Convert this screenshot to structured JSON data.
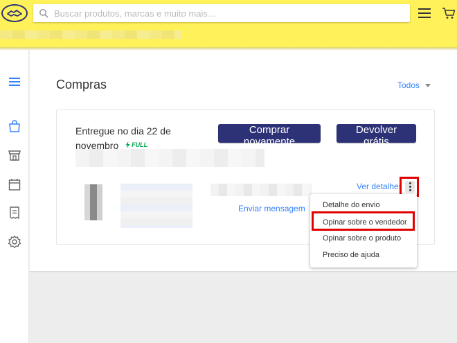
{
  "header": {
    "logo_icon": "mercadolivre-handshake-logo",
    "search": {
      "placeholder": "Buscar produtos, marcas e muito mais…",
      "value": ""
    },
    "menu_icon": "hamburger-menu-icon",
    "cart_icon": "cart-icon",
    "accent": "#fff159"
  },
  "sidebar": {
    "items": [
      {
        "icon": "hamburger-icon"
      },
      {
        "icon": "shopping-bag-icon",
        "active": true
      },
      {
        "icon": "store-icon"
      },
      {
        "icon": "calendar-icon"
      },
      {
        "icon": "receipt-icon"
      },
      {
        "icon": "settings-icon"
      }
    ]
  },
  "main": {
    "title": "Compras",
    "filter": {
      "label": "Todos"
    },
    "order": {
      "delivery_text": "Entregue no dia 22 de novembro",
      "full_badge": "FULL",
      "buy_again_label": "Comprar novamente",
      "return_label": "Devolver grátis",
      "send_message_label": "Enviar mensagem",
      "see_details_label": "Ver detalhes",
      "more_icon": "kebab-menu-icon"
    },
    "actions_menu": {
      "items": [
        {
          "label": "Detalhe do envio"
        },
        {
          "label": "Opinar sobre o vendedor",
          "highlighted": true
        },
        {
          "label": "Opinar sobre o produto"
        },
        {
          "label": "Preciso de ajuda"
        }
      ]
    }
  },
  "colors": {
    "primary_button": "#2d3277",
    "link": "#3483fa",
    "highlight_box": "#e00000",
    "full_green": "#00a650"
  }
}
